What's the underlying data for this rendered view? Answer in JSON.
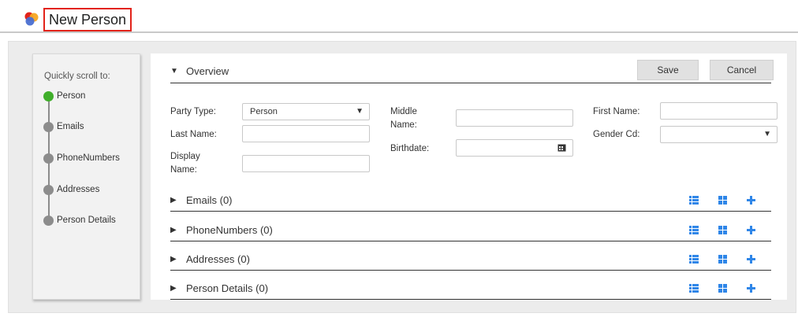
{
  "header": {
    "title": "New Person"
  },
  "nav": {
    "title": "Quickly scroll to:",
    "items": [
      {
        "label": "Person",
        "active": true
      },
      {
        "label": "Emails",
        "active": false
      },
      {
        "label": "PhoneNumbers",
        "active": false
      },
      {
        "label": "Addresses",
        "active": false
      },
      {
        "label": "Person Details",
        "active": false
      }
    ]
  },
  "overview": {
    "label": "Overview"
  },
  "buttons": {
    "save": "Save",
    "cancel": "Cancel"
  },
  "form": {
    "party_type_label": "Party Type:",
    "party_type_value": "Person",
    "last_name_label": "Last Name:",
    "last_name_value": "",
    "display_name_label_1": "Display",
    "display_name_label_2": "Name:",
    "display_name_value": "",
    "middle_name_label_1": "Middle",
    "middle_name_label_2": "Name:",
    "middle_name_value": "",
    "birthdate_label": "Birthdate:",
    "birthdate_value": "",
    "first_name_label": "First Name:",
    "first_name_value": "",
    "gender_label": "Gender Cd:",
    "gender_value": ""
  },
  "sections": [
    {
      "label": "Emails (0)"
    },
    {
      "label": "PhoneNumbers (0)"
    },
    {
      "label": "Addresses (0)"
    },
    {
      "label": "Person Details (0)"
    }
  ],
  "icons": {
    "logo": "app-logo-icon",
    "expanded": "caret-down-icon",
    "collapsed": "caret-right-icon",
    "list": "list-view-icon",
    "grid": "grid-view-icon",
    "add": "plus-icon",
    "calendar": "calendar-icon"
  },
  "colors": {
    "accent_blue": "#2f86e8",
    "active_green": "#3fae2a",
    "title_border": "#e2231a"
  }
}
